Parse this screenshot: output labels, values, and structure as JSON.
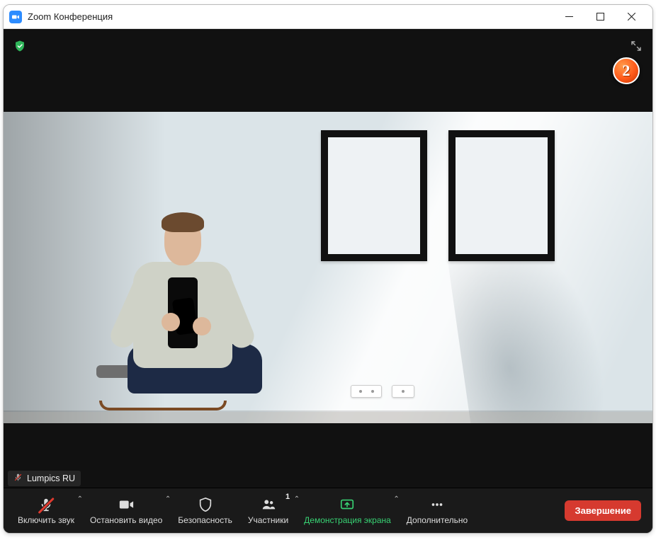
{
  "window": {
    "title": "Zoom Конференция"
  },
  "overlay": {
    "step_number": "2"
  },
  "participant": {
    "name": "Lumpics RU"
  },
  "toolbar": {
    "mute_label": "Включить звук",
    "video_label": "Остановить видео",
    "security_label": "Безопасность",
    "participants_label": "Участники",
    "participants_count": "1",
    "share_label": "Демонстрация экрана",
    "more_label": "Дополнительно",
    "end_label": "Завершение"
  }
}
